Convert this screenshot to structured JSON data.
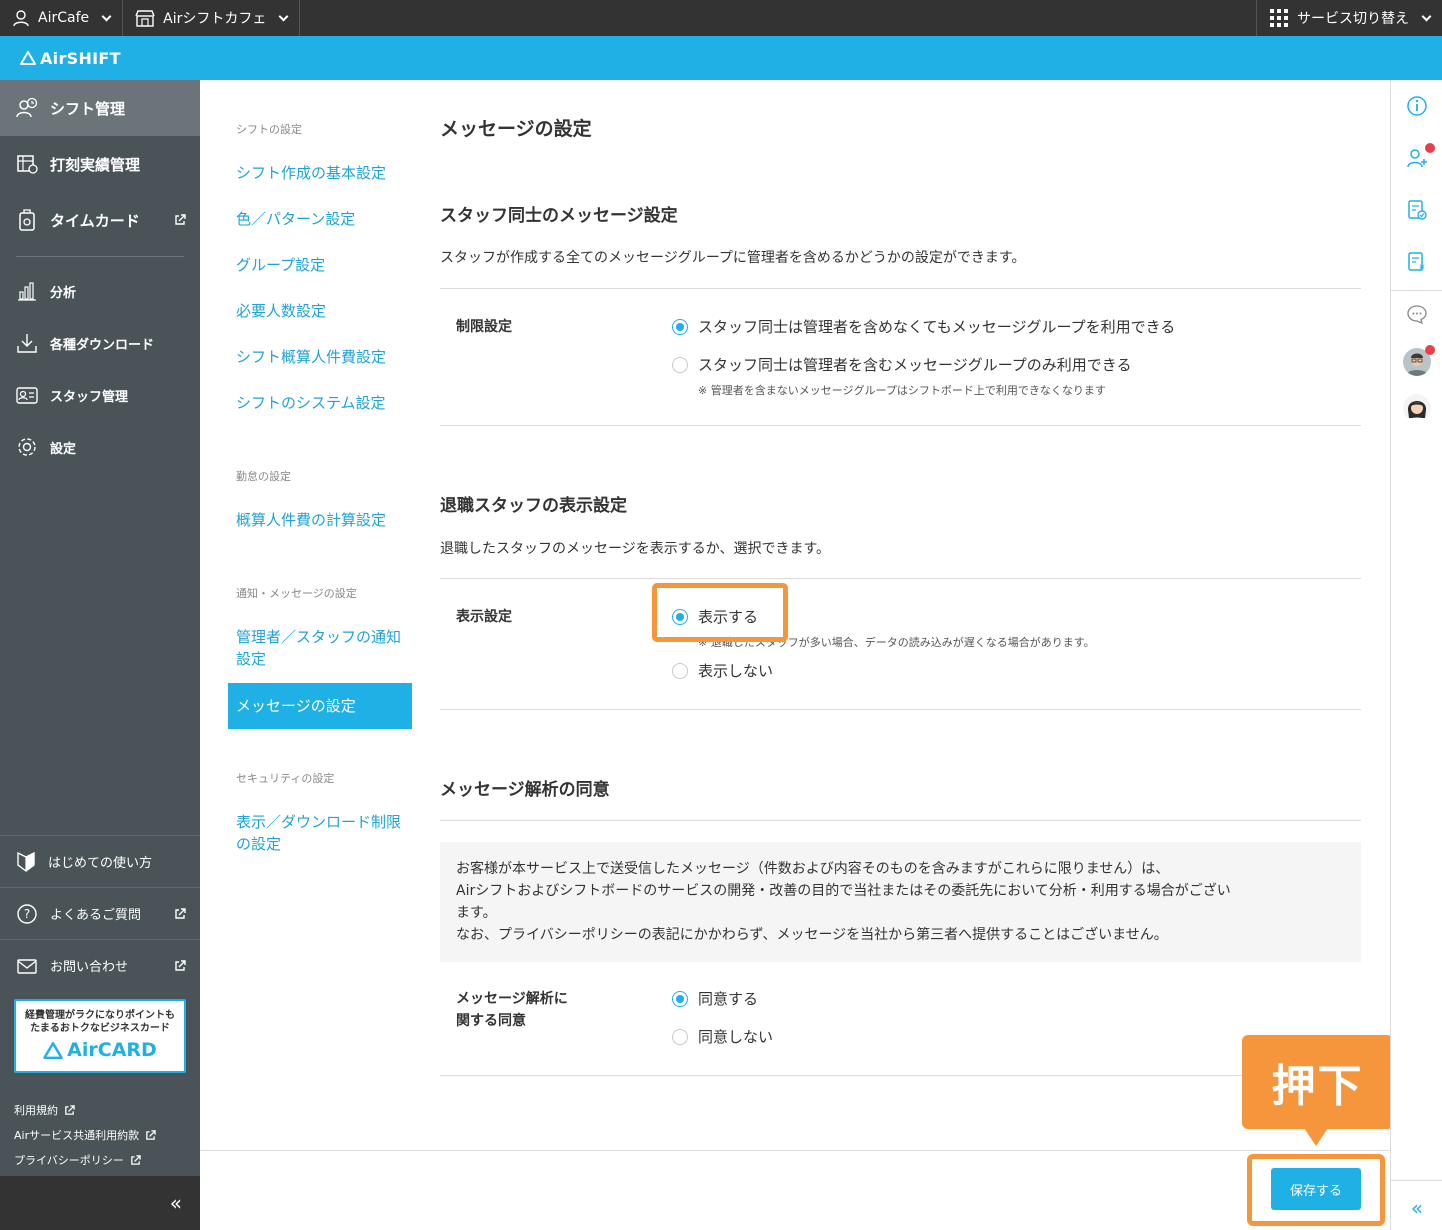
{
  "topbar": {
    "account": "AirCafe",
    "store": "Airシフトカフェ",
    "service_switch": "サービス切り替え"
  },
  "brand": {
    "name": "AirSHIFT"
  },
  "sidebar": {
    "main_items": [
      {
        "label": "シフト管理",
        "icon": "shift-icon",
        "active": true
      },
      {
        "label": "打刻実績管理",
        "icon": "timesheet-icon"
      },
      {
        "label": "タイムカード",
        "icon": "timecard-icon",
        "external": true
      }
    ],
    "sub_items": [
      {
        "label": "分析",
        "icon": "chart-icon"
      },
      {
        "label": "各種ダウンロード",
        "icon": "download-icon"
      },
      {
        "label": "スタッフ管理",
        "icon": "staff-card-icon"
      },
      {
        "label": "設定",
        "icon": "gear-icon"
      }
    ],
    "bottom_items": [
      {
        "label": "はじめての使い方",
        "icon": "beginner-mark-icon"
      },
      {
        "label": "よくあるご質問",
        "icon": "question-icon",
        "external": true
      },
      {
        "label": "お問い合わせ",
        "icon": "mail-icon",
        "external": true
      }
    ],
    "aircard": {
      "line1": "経費管理がラクになりポイントも",
      "line2": "たまるおトクなビジネスカード",
      "logo": "AirCARD"
    },
    "legal": [
      "利用規約",
      "Airサービス共通利用約款",
      "プライバシーポリシー"
    ],
    "collapse": "«"
  },
  "subnav": {
    "groups": [
      {
        "heading": "シフトの設定",
        "links": [
          "シフト作成の基本設定",
          "色／パターン設定",
          "グループ設定",
          "必要人数設定",
          "シフト概算人件費設定",
          "シフトのシステム設定"
        ]
      },
      {
        "heading": "勤怠の設定",
        "links": [
          "概算人件費の計算設定"
        ]
      },
      {
        "heading": "通知・メッセージの設定",
        "links": [
          "管理者／スタッフの通知設定",
          "メッセージの設定"
        ]
      },
      {
        "heading": "セキュリティの設定",
        "links": [
          "表示／ダウンロード制限の設定"
        ]
      }
    ],
    "active": "メッセージの設定"
  },
  "main": {
    "page_title": "メッセージの設定",
    "sections": [
      {
        "title": "スタッフ同士のメッセージ設定",
        "desc": "スタッフが作成する全てのメッセージグループに管理者を含めるかどうかの設定ができます。",
        "label": "制限設定",
        "options": [
          "スタッフ同士は管理者を含めなくてもメッセージグループを利用できる",
          "スタッフ同士は管理者を含むメッセージグループのみ利用できる"
        ],
        "selected": 0,
        "note": "※ 管理者を含まないメッセージグループはシフトボード上で利用できなくなります"
      },
      {
        "title": "退職スタッフの表示設定",
        "desc": "退職したスタッフのメッセージを表示するか、選択できます。",
        "label": "表示設定",
        "options": [
          "表示する",
          "表示しない"
        ],
        "selected": 0,
        "note": "※ 退職したスタッフが多い場合、データの読み込みが遅くなる場合があります。"
      },
      {
        "title": "メッセージ解析の同意",
        "consent_lines": [
          "お客様が本サービス上で送受信したメッセージ（件数および内容そのものを含みますがこれらに限りません）は、",
          "Airシフトおよびシフトボードのサービスの開発・改善の目的で当社またはその委託先において分析・利用する場合がござい",
          "ます。",
          "なお、プライバシーポリシーの表記にかかわらず、メッセージを当社から第三者へ提供することはございません。"
        ],
        "label_line1": "メッセージ解析に",
        "label_line2": "関する同意",
        "options": [
          "同意する",
          "同意しない"
        ],
        "selected": 0
      }
    ],
    "save_label": "保存する"
  },
  "annotation": {
    "callout": "押下"
  },
  "rightrail": {
    "collapse": "«"
  },
  "colors": {
    "accent": "#1fb1e6",
    "highlight": "#f5963c",
    "sidebar": "#4a5357",
    "topbar": "#333333"
  }
}
